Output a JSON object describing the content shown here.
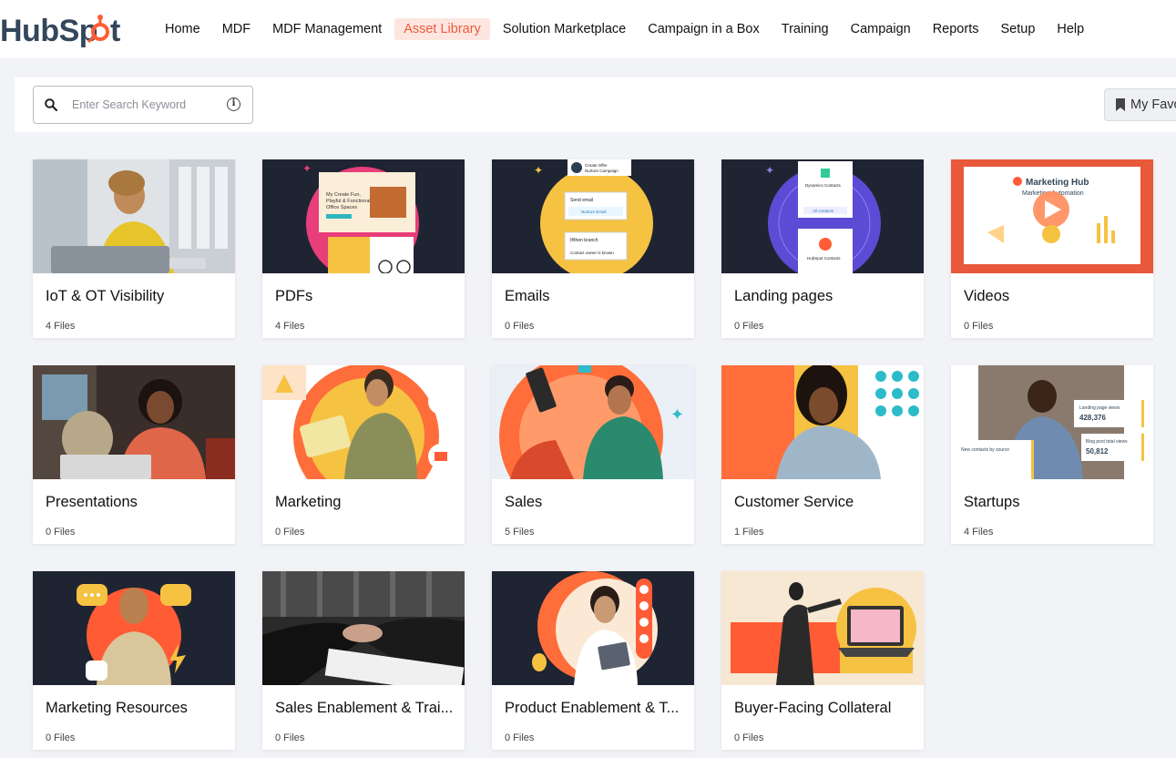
{
  "brand": {
    "logo_text": "HubSpot",
    "accent": "#ef5b3b"
  },
  "nav": {
    "items": [
      {
        "label": "Home"
      },
      {
        "label": "MDF"
      },
      {
        "label": "MDF Management"
      },
      {
        "label": "Asset Library"
      },
      {
        "label": "Solution Marketplace"
      },
      {
        "label": "Campaign in a Box"
      },
      {
        "label": "Training"
      },
      {
        "label": "Campaign"
      },
      {
        "label": "Reports"
      },
      {
        "label": "Setup"
      },
      {
        "label": "Help"
      }
    ],
    "active": "Asset Library"
  },
  "search": {
    "placeholder": "Enter Search Keyword",
    "value": ""
  },
  "favorites": {
    "label": "My Favo"
  },
  "cards": [
    {
      "title": "IoT & OT Visibility",
      "count": "4 Files"
    },
    {
      "title": "PDFs",
      "count": "4 Files"
    },
    {
      "title": "Emails",
      "count": "0 Files"
    },
    {
      "title": "Landing pages",
      "count": "0 Files"
    },
    {
      "title": "Videos",
      "count": "0 Files"
    },
    {
      "title": "Presentations",
      "count": "0 Files"
    },
    {
      "title": "Marketing",
      "count": "0 Files"
    },
    {
      "title": "Sales",
      "count": "5 Files"
    },
    {
      "title": "Customer Service",
      "count": "1 Files"
    },
    {
      "title": "Startups",
      "count": "4 Files"
    },
    {
      "title": "Marketing Resources",
      "count": "0 Files"
    },
    {
      "title": "Sales Enablement & Trai...",
      "count": "0 Files"
    },
    {
      "title": "Product Enablement & T...",
      "count": "0 Files"
    },
    {
      "title": "Buyer-Facing Collateral",
      "count": "0 Files"
    }
  ],
  "thumb_text": {
    "videos_title": "Marketing Hub",
    "videos_sub": "Marketing Automation",
    "startups_stat1_label": "Landing page views",
    "startups_stat1_value": "428,376",
    "startups_stat2_label": "Blog post total views",
    "startups_stat2_value": "50,812",
    "startups_panel_label": "New contacts by source",
    "emails_head": "Create Offer Nurture Campaign",
    "emails_row1": "Send email",
    "emails_row2": "Nurture Email",
    "emails_row3": "If/then branch",
    "emails_row4": "Contact owner is known",
    "landing_top": "Dynamics Contacts",
    "landing_bottom": "HubSpot Contacts",
    "landing_filter": "All contacts"
  }
}
